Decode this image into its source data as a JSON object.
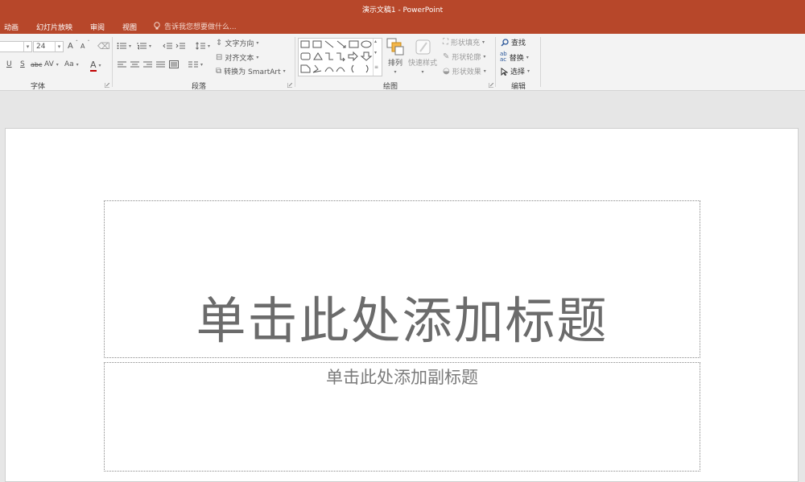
{
  "window": {
    "title": "演示文稿1 - PowerPoint"
  },
  "menu": {
    "items": [
      "动画",
      "幻灯片放映",
      "审阅",
      "视图"
    ],
    "tell_me_placeholder": "告诉我您想要做什么..."
  },
  "ribbon": {
    "font_group": {
      "label": "字体",
      "font_name": "",
      "font_size": "24",
      "grow_font": "A",
      "shrink_font": "A",
      "underline": "U",
      "shadow": "S",
      "strike": "abc",
      "spacing": "AV",
      "change_case": "Aa",
      "font_color": "A"
    },
    "paragraph_group": {
      "label": "段落",
      "text_direction": "文字方向",
      "align_text": "对齐文本",
      "convert_smartart": "转换为 SmartArt"
    },
    "drawing_group": {
      "label": "绘图",
      "arrange": "排列",
      "quick_styles": "快速样式",
      "shape_fill": "形状填充",
      "shape_outline": "形状轮廓",
      "shape_effects": "形状效果"
    },
    "editing_group": {
      "label": "编辑",
      "find": "查找",
      "replace": "替换",
      "select": "选择"
    }
  },
  "slide": {
    "title_placeholder": "单击此处添加标题",
    "subtitle_placeholder": "单击此处添加副标题"
  },
  "colors": {
    "accent": "#b7472a",
    "ribbon_bg": "#f3f3f3",
    "workspace_bg": "#e6e6e6"
  }
}
